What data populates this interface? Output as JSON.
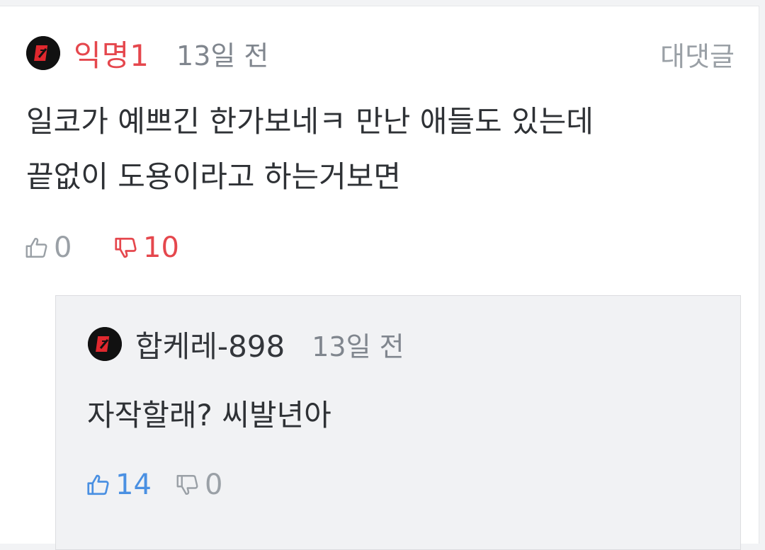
{
  "comment": {
    "author": "익명1",
    "time": "13일 전",
    "reply_label": "대댓글",
    "body": "일코가 예쁘긴 한가보네ㅋ 만난 애들도 있는데\n끝없이 도용이라고 하는거보면",
    "likes": "0",
    "dislikes": "10"
  },
  "reply": {
    "author": "합케레-898",
    "time": "13일 전",
    "body": "자작할래? 씨발년아",
    "likes": "14",
    "dislikes": "0"
  },
  "colors": {
    "accent_red": "#e5474d",
    "accent_blue": "#4a90e2",
    "muted_gray": "#9aa0a6"
  },
  "icons": {
    "avatar": "avatar-logo-icon",
    "like": "thumbs-up-icon",
    "dislike": "thumbs-down-icon"
  }
}
